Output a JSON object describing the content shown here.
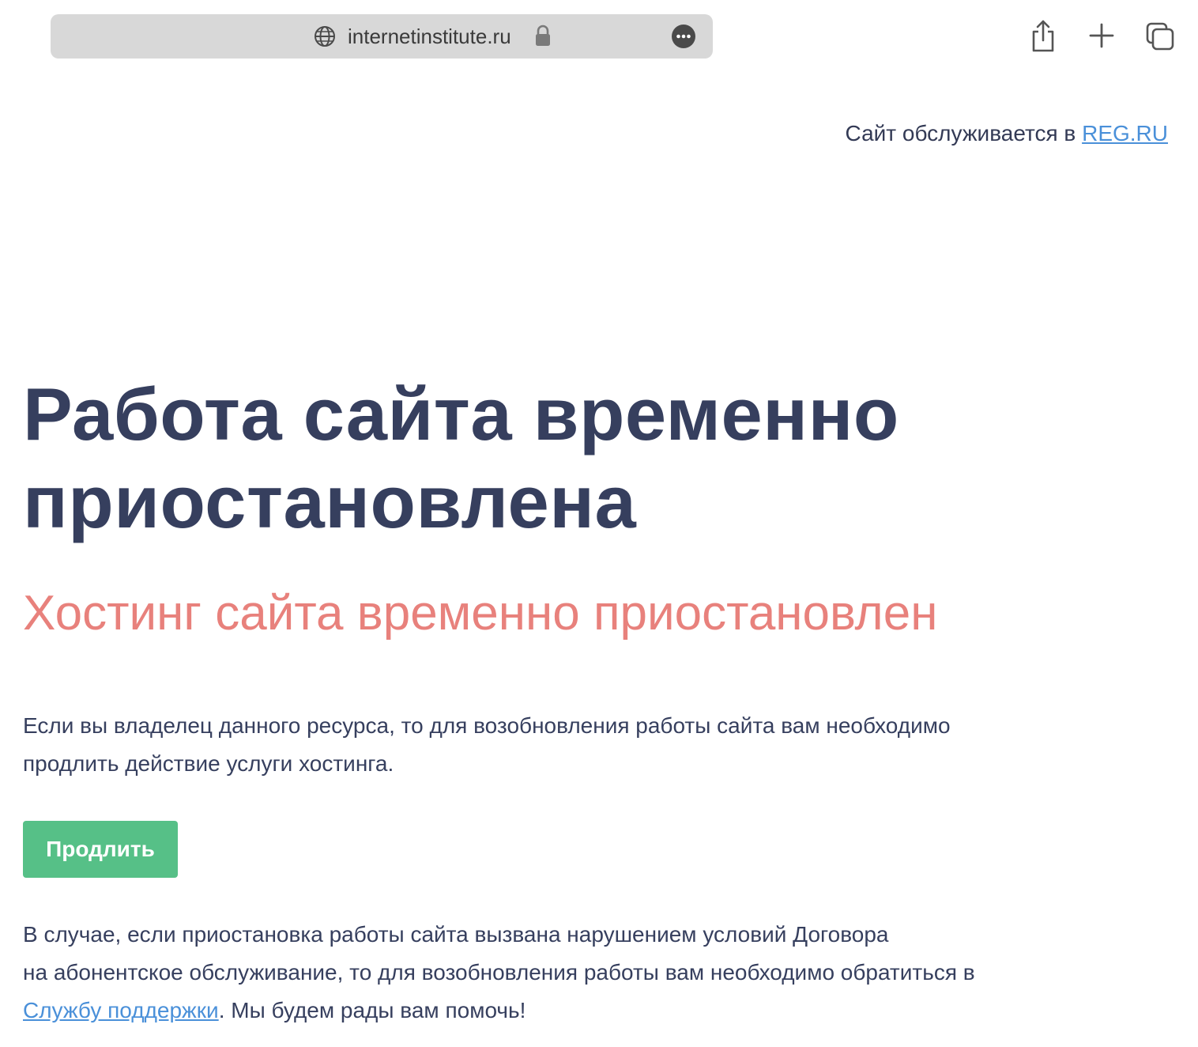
{
  "browser": {
    "url": "internetinstitute.ru",
    "icons": {
      "globe": "globe-icon",
      "lock": "lock-icon",
      "more": "more-options-icon",
      "share": "share-icon",
      "new_tab": "plus-icon",
      "tabs": "tabs-icon"
    }
  },
  "header": {
    "served_prefix": "Сайт обслуживается в ",
    "served_link": "REG.RU"
  },
  "main": {
    "title_line1": "Работа сайта временно",
    "title_line2": "приостановлена",
    "subtitle": "Хостинг сайта временно приостановлен",
    "para1_line1": "Если вы владелец данного ресурса, то для возобновления работы сайта вам необходимо",
    "para1_line2": "продлить действие услуги хостинга.",
    "renew_button": "Продлить",
    "para2_line1": "В случае, если приостановка работы сайта вызвана нарушением условий Договора",
    "para2_line2": "на абонентское обслуживание, то для возобновления работы вам необходимо обратиться в",
    "para2_link": "Службу поддержки",
    "para2_tail": ". Мы будем рады вам помочь!"
  },
  "colors": {
    "title": "#363f5e",
    "subtitle": "#e8817c",
    "link": "#4a90d9",
    "button": "#56c087",
    "address_bar": "#d8d8d8"
  }
}
